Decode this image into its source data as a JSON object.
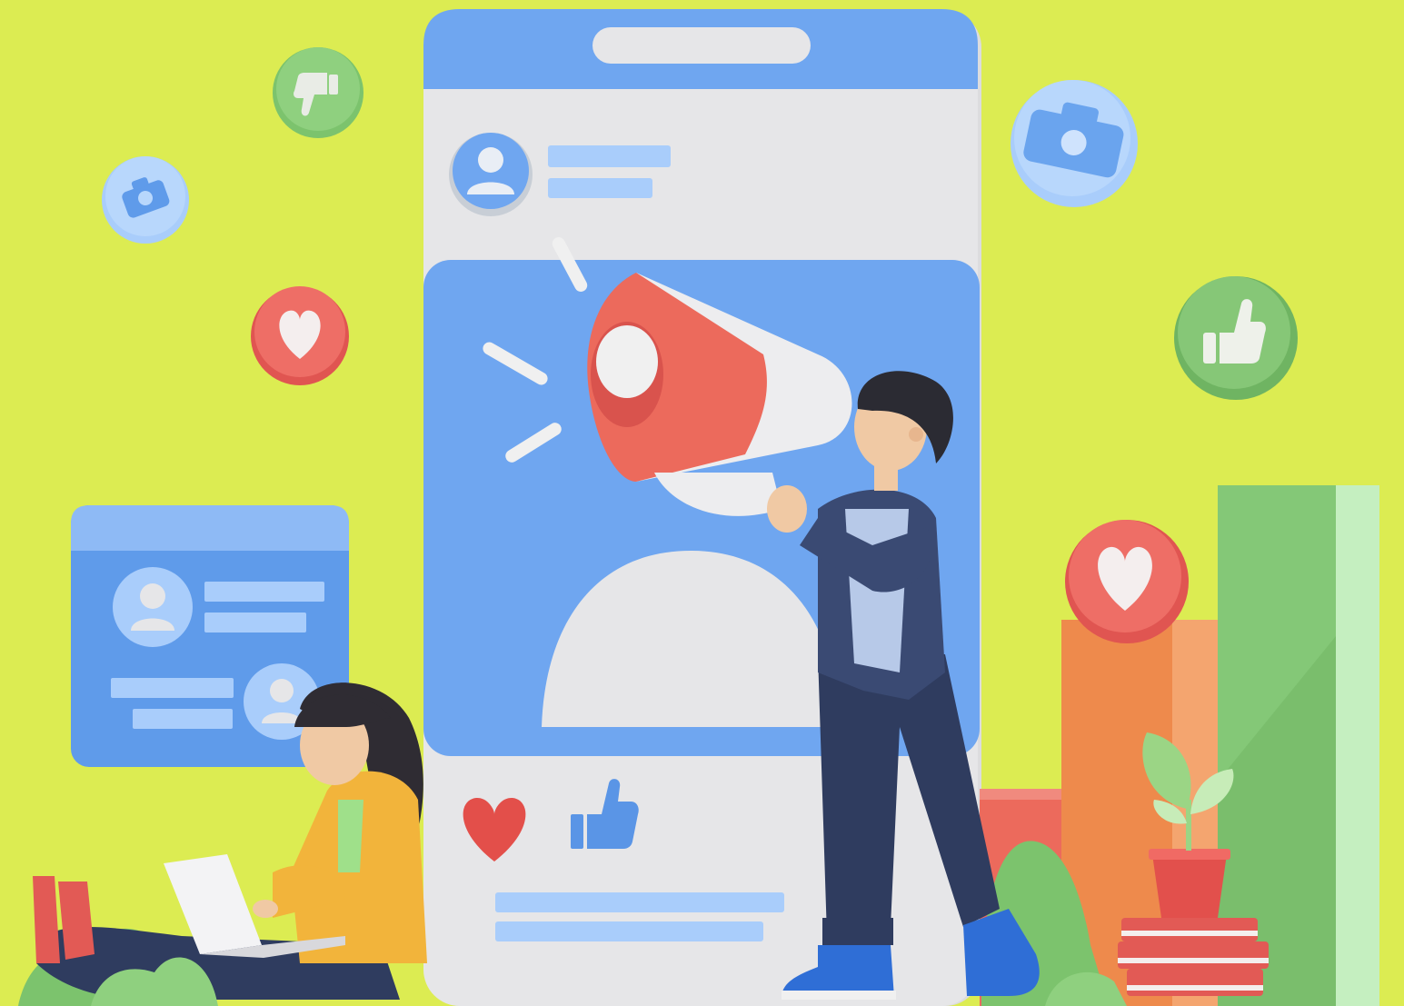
{
  "colors": {
    "background": "#dcec52",
    "phone_body": "#e4e4e6",
    "phone_blue": "#6fa6f0",
    "light_blue": "#a9cdfb",
    "heart_red": "#e8605a",
    "like_green": "#7cc36d",
    "bar_orange": "#ee8a4c",
    "bar_green": "#84c877",
    "suit_navy": "#3a4a73",
    "sweater_yellow": "#f2b43b",
    "shoe_blue": "#2f6ed6"
  },
  "icons": [
    "thumbs-down-icon",
    "camera-icon",
    "heart-icon",
    "camera-icon",
    "thumbs-up-icon",
    "heart-icon",
    "user-avatar-icon",
    "megaphone-icon",
    "plant-icon",
    "laptop-icon"
  ],
  "scene": {
    "description_items": [
      "phone-mockup",
      "profile-card",
      "bar-chart",
      "man-with-megaphone",
      "woman-with-laptop"
    ]
  }
}
